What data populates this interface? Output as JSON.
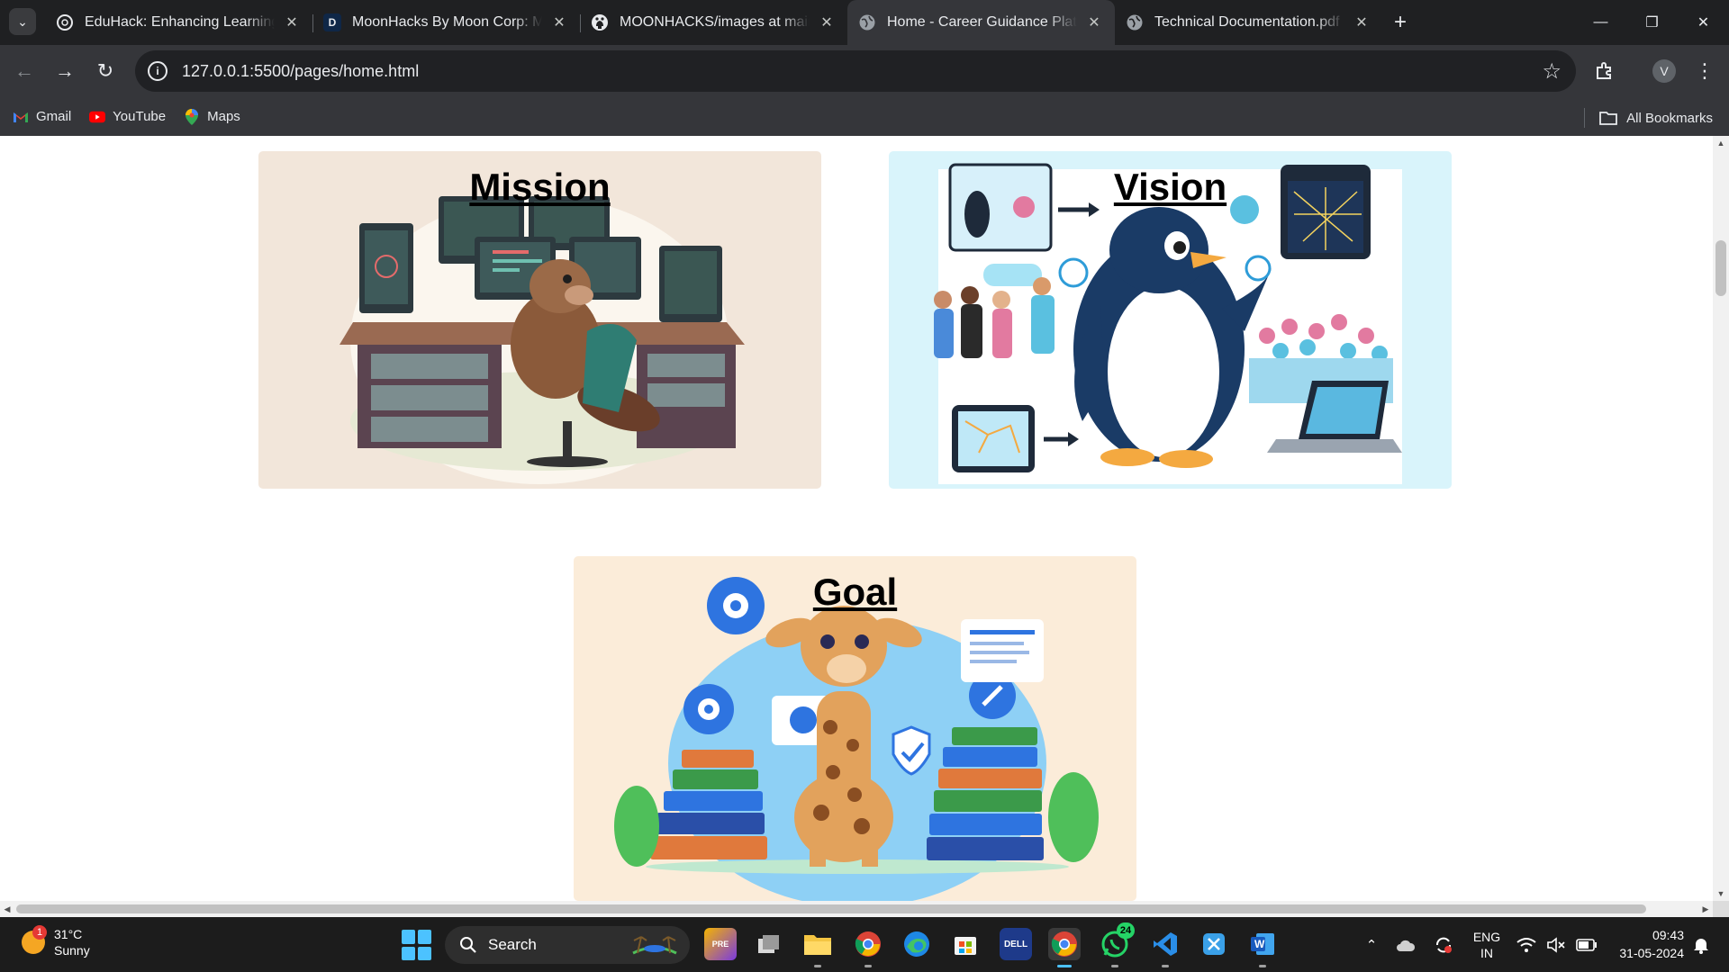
{
  "browser": {
    "tabs": [
      {
        "title": "EduHack: Enhancing Learning E",
        "icon": "chatgpt-icon",
        "active": false
      },
      {
        "title": "MoonHacks By Moon Corp: Mo",
        "icon": "devfolio-icon",
        "active": false
      },
      {
        "title": "MOONHACKS/images at main ·",
        "icon": "github-icon",
        "active": false
      },
      {
        "title": "Home - Career Guidance Platfor",
        "icon": "globe-icon",
        "active": true
      },
      {
        "title": "Technical Documentation.pdf",
        "icon": "globe-icon",
        "active": false
      }
    ],
    "url": "127.0.0.1:5500/pages/home.html",
    "profile_initial": "V",
    "bookmarks": [
      {
        "label": "Gmail",
        "icon": "gmail-icon"
      },
      {
        "label": "YouTube",
        "icon": "youtube-icon"
      },
      {
        "label": "Maps",
        "icon": "maps-icon"
      }
    ],
    "all_bookmarks": "All Bookmarks"
  },
  "page": {
    "cards": {
      "mission": {
        "title": "Mission",
        "image": "beaver-coding-at-desk-illustration"
      },
      "vision": {
        "title": "Vision",
        "image": "penguin-presenting-network-illustration"
      },
      "goal": {
        "title": "Goal",
        "image": "giraffe-with-books-and-tech-icons-illustration"
      }
    }
  },
  "taskbar": {
    "weather": {
      "temp": "31°C",
      "condition": "Sunny",
      "badge": "1"
    },
    "search_label": "Search",
    "whatsapp_badge": "24",
    "dell_label": "DELL",
    "word_label": "W",
    "language": {
      "line1": "ENG",
      "line2": "IN"
    },
    "time": "09:43",
    "date": "31-05-2024"
  },
  "colors": {
    "tab_strip": "#1f2022",
    "toolbar": "#35363a",
    "mission_bg": "#f2e6da",
    "vision_bg": "#d9f4fb",
    "goal_bg": "#fbecd9",
    "taskbar": "#1c1c1c",
    "accent": "#4cc2ff"
  }
}
